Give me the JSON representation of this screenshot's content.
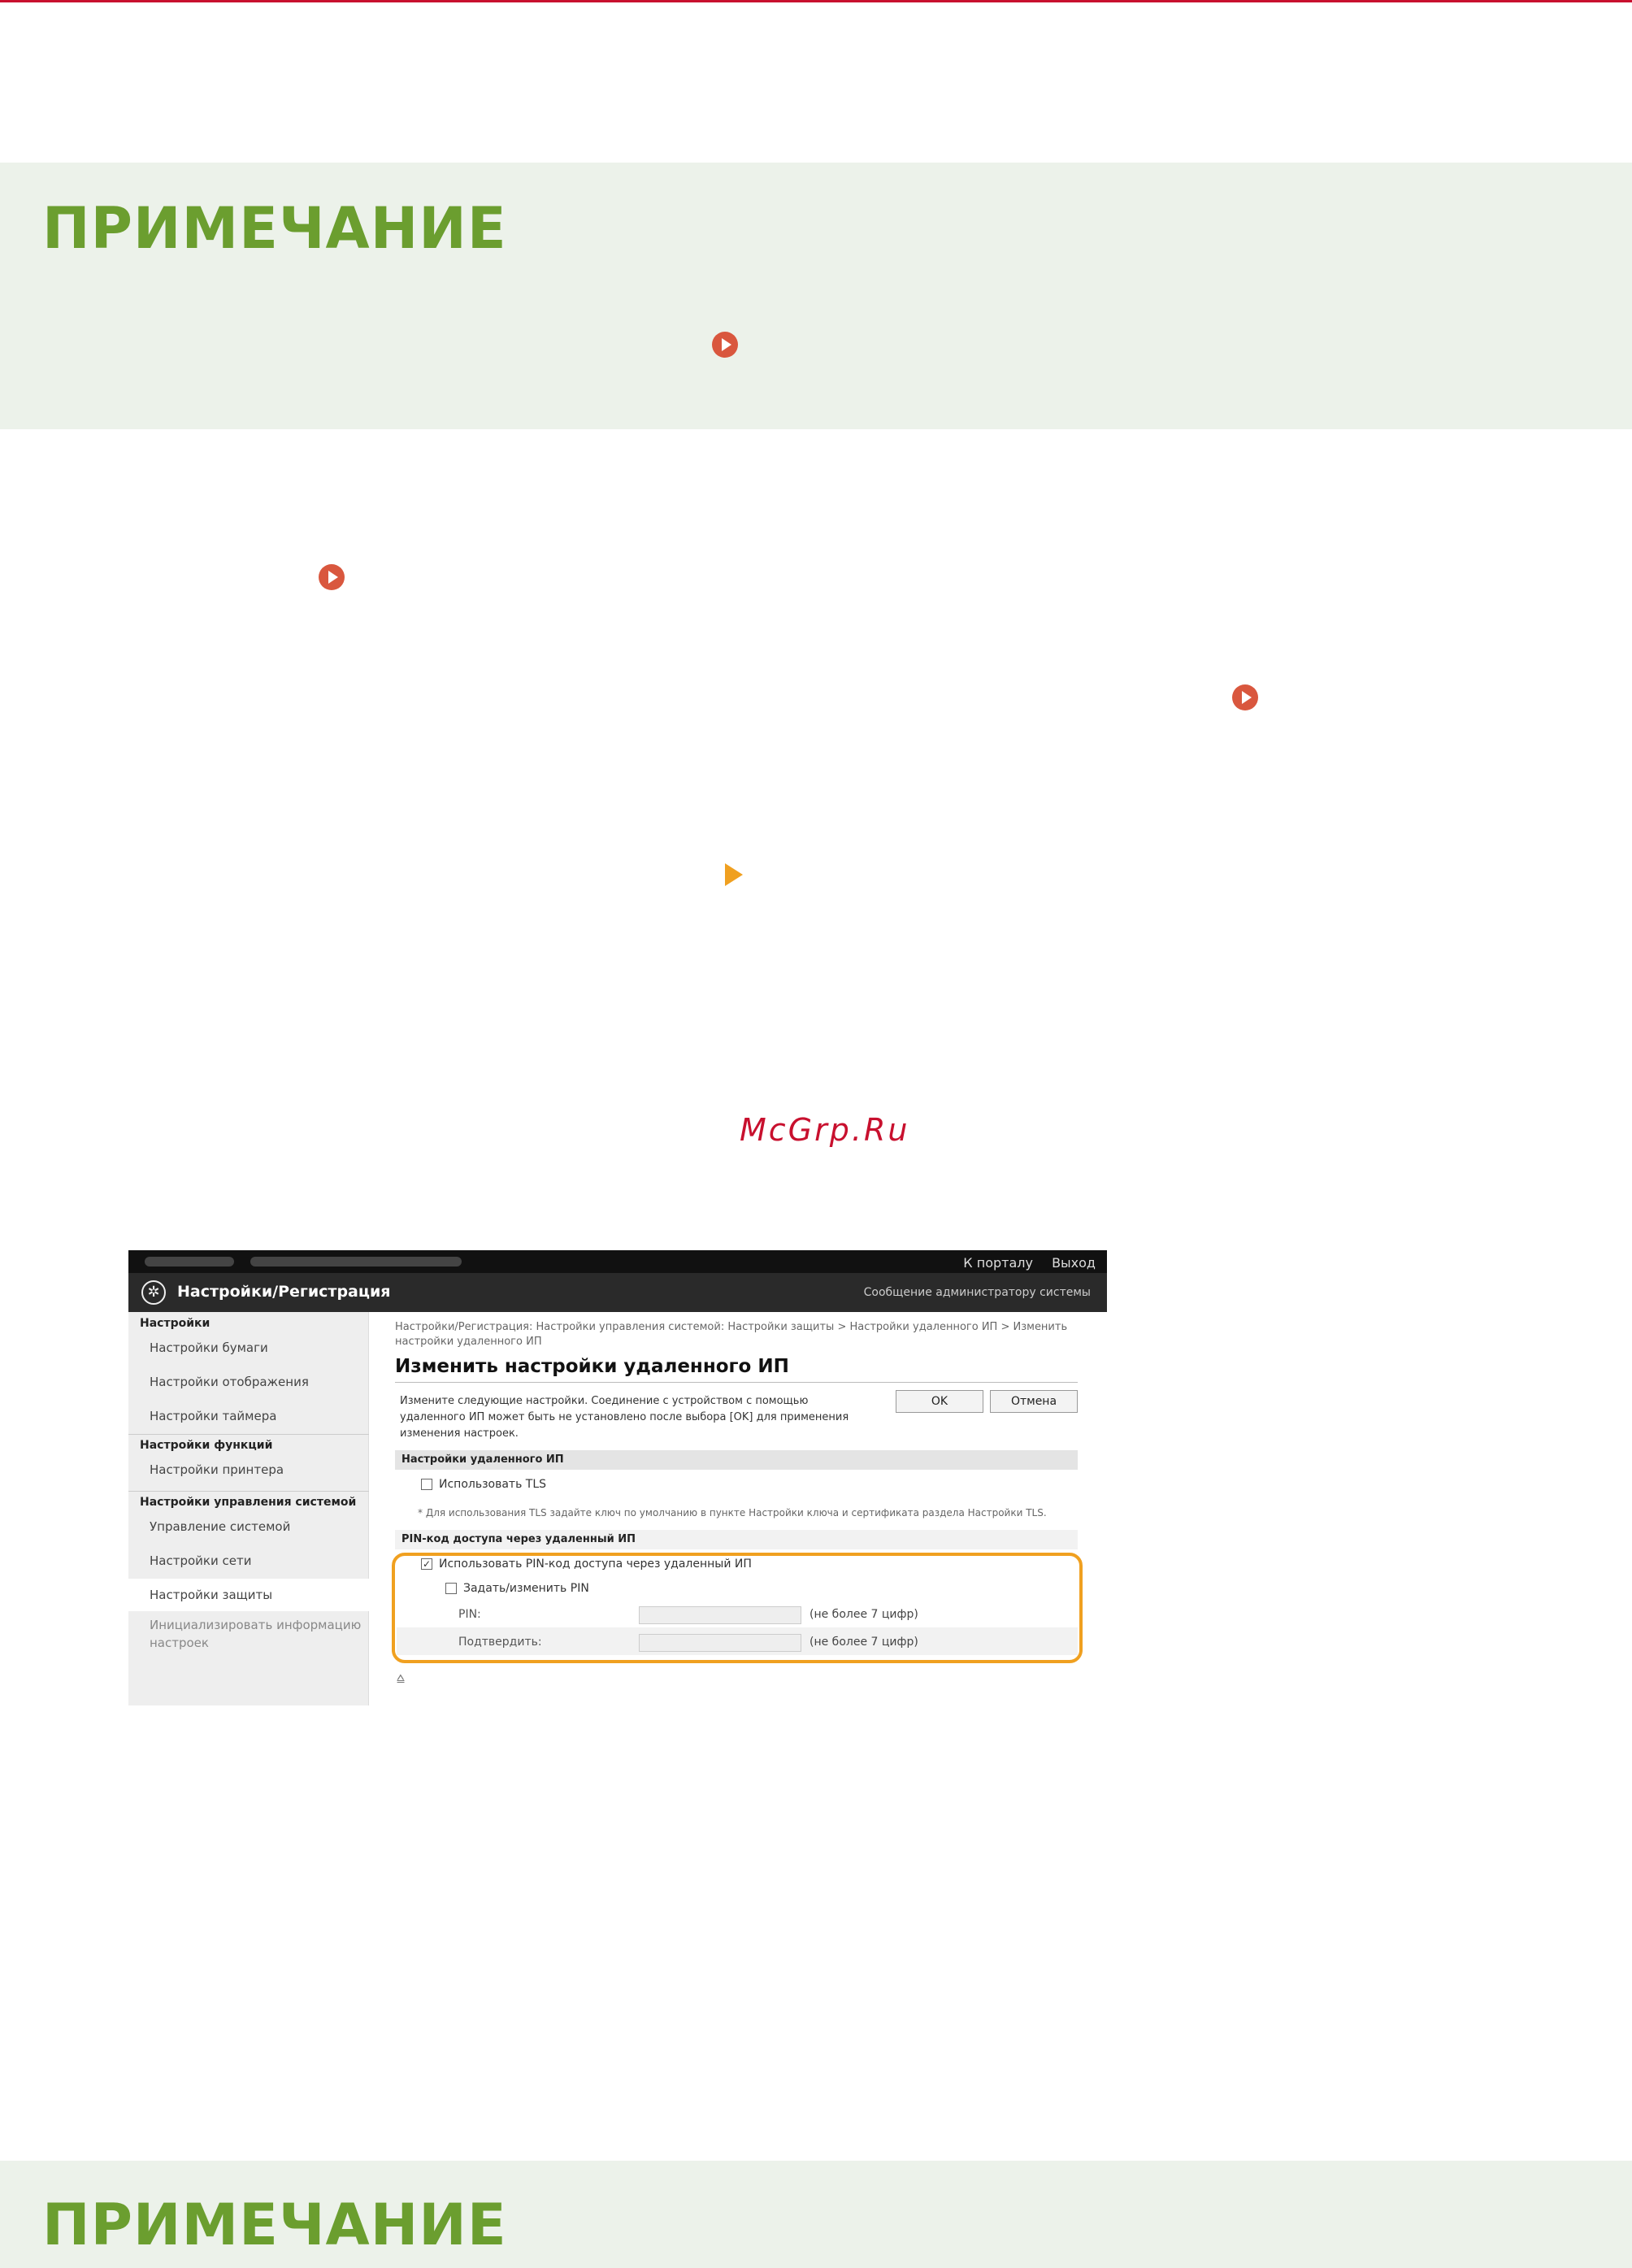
{
  "note_title_1": "ПРИМЕЧАНИЕ",
  "note_title_2": "ПРИМЕЧАНИЕ",
  "watermark": "McGrp.Ru",
  "screenshot": {
    "top_links": [
      "К порталу",
      "Выход"
    ],
    "header_title": "Настройки/Регистрация",
    "header_message": "Сообщение администратору системы",
    "sidebar": {
      "section_settings": "Настройки",
      "items_settings": [
        "Настройки бумаги",
        "Настройки отображения",
        "Настройки таймера"
      ],
      "section_functions": "Настройки функций",
      "items_functions": [
        "Настройки принтера"
      ],
      "section_system": "Настройки управления системой",
      "items_system": [
        "Управление системой",
        "Настройки сети",
        "Настройки защиты",
        "Инициализировать информацию настроек"
      ]
    },
    "breadcrumb": "Настройки/Регистрация: Настройки управления системой: Настройки защиты > Настройки удаленного ИП > Изменить настройки удаленного ИП",
    "page_title": "Изменить настройки удаленного ИП",
    "description": "Измените следующие настройки. Соединение с устройством с помощью удаленного ИП может быть не установлено после выбора [OK] для применения изменения настроек.",
    "ok_button": "OK",
    "cancel_button": "Отмена",
    "section_remote_ui": "Настройки удаленного ИП",
    "use_tls": "Использовать TLS",
    "tls_note": "* Для использования TLS задайте ключ по умолчанию в пункте Настройки ключа и сертификата раздела Настройки TLS.",
    "section_pin": "PIN-код доступа через удаленный ИП",
    "use_pin": "Использовать PIN-код доступа через удаленный ИП",
    "set_change_pin": "Задать/изменить PIN",
    "pin_label": "PIN:",
    "confirm_label": "Подтвердить:",
    "pin_hint": "(не более 7 цифр)",
    "confirm_hint": "(не более 7 цифр)",
    "to_top": "⩠"
  }
}
